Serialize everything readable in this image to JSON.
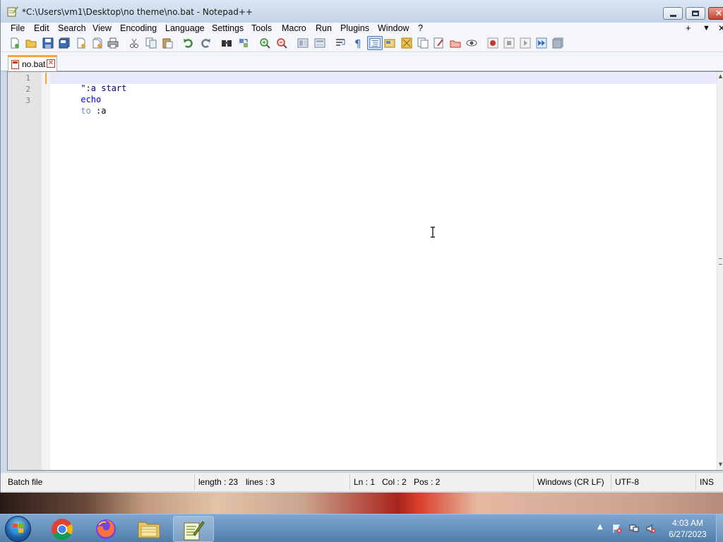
{
  "window": {
    "title": "*C:\\Users\\vm1\\Desktop\\no theme\\no.bat - Notepad++"
  },
  "menu": [
    "File",
    "Edit",
    "Search",
    "View",
    "Encoding",
    "Language",
    "Settings",
    "Tools",
    "Macro",
    "Run",
    "Plugins",
    "Window",
    "?"
  ],
  "menu_right": {
    "plus": "+",
    "dropdown": "▼",
    "close": "✕"
  },
  "tab": {
    "label": "no.bat"
  },
  "editor": {
    "lines": [
      {
        "num": "1",
        "tokens": [
          "\":a start"
        ]
      },
      {
        "num": "2",
        "tokens": [
          "echo"
        ]
      },
      {
        "num": "3",
        "tokens": [
          "to",
          " :a"
        ]
      }
    ]
  },
  "status": {
    "filetype": "Batch file",
    "length": "length : 23",
    "lines": "lines : 3",
    "ln": "Ln : 1",
    "col": "Col : 2",
    "pos": "Pos : 2",
    "eol": "Windows (CR LF)",
    "encoding": "UTF-8",
    "mode": "INS"
  },
  "taskbar": {
    "time": "4:03 AM",
    "date": "6/27/2023"
  },
  "icons": {
    "toolbar": [
      "new-file-icon",
      "open-file-icon",
      "save-icon",
      "save-all-icon",
      "close-icon",
      "close-all-icon",
      "print-icon",
      "cut-icon",
      "copy-icon",
      "paste-icon",
      "undo-icon",
      "redo-icon",
      "find-icon",
      "replace-icon",
      "zoom-in-icon",
      "zoom-out-icon",
      "sync-vertical-icon",
      "sync-horizontal-icon",
      "word-wrap-icon",
      "show-all-chars-icon",
      "indent-guide-icon",
      "language-icon",
      "doc-map-icon",
      "function-list-icon",
      "folder-workspace-icon",
      "monitor-icon",
      "record-macro-icon",
      "stop-macro-icon",
      "play-macro-icon",
      "run-macro-multiple-icon",
      "save-macro-icon"
    ]
  }
}
